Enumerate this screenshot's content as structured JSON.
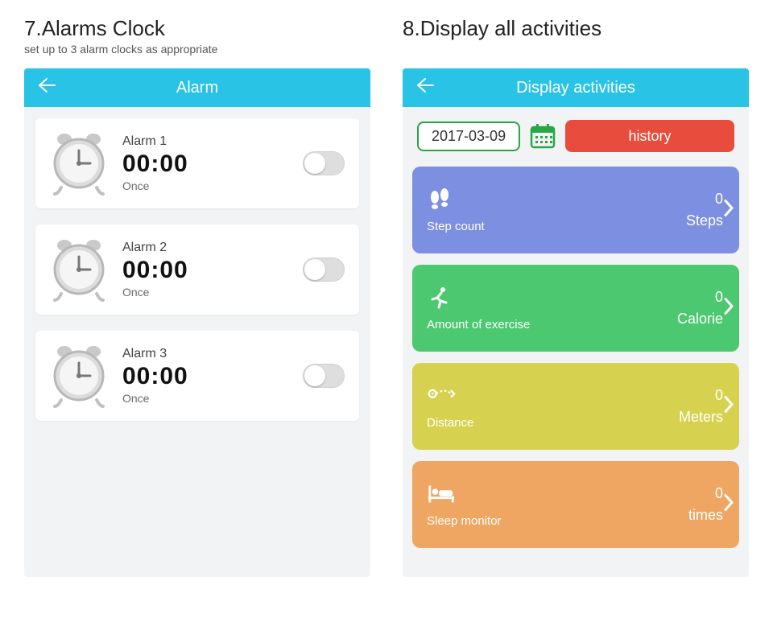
{
  "sections": {
    "alarm": {
      "num": "7.",
      "title": "Alarms Clock",
      "subtitle": "set up to 3 alarm clocks as appropriate",
      "appbar_title": "Alarm",
      "items": [
        {
          "name": "Alarm 1",
          "time": "00:00",
          "repeat": "Once"
        },
        {
          "name": "Alarm 2",
          "time": "00:00",
          "repeat": "Once"
        },
        {
          "name": "Alarm 3",
          "time": "00:00",
          "repeat": "Once"
        }
      ]
    },
    "activities": {
      "num": "8.",
      "title": "Display all activities",
      "subtitle": "",
      "appbar_title": "Display activities",
      "date": "2017-03-09",
      "history_label": "history",
      "cards": [
        {
          "label": "Step count",
          "value": "0",
          "unit": "Steps",
          "cls": "c-steps",
          "icon": "footprints-icon"
        },
        {
          "label": "Amount of exercise",
          "value": "0",
          "unit": "Calorie",
          "cls": "c-ex",
          "icon": "runner-icon"
        },
        {
          "label": "Distance",
          "value": "0",
          "unit": "Meters",
          "cls": "c-dist",
          "icon": "route-icon"
        },
        {
          "label": "Sleep monitor",
          "value": "0",
          "unit": "times",
          "cls": "c-sleep",
          "icon": "bed-icon"
        }
      ]
    }
  }
}
